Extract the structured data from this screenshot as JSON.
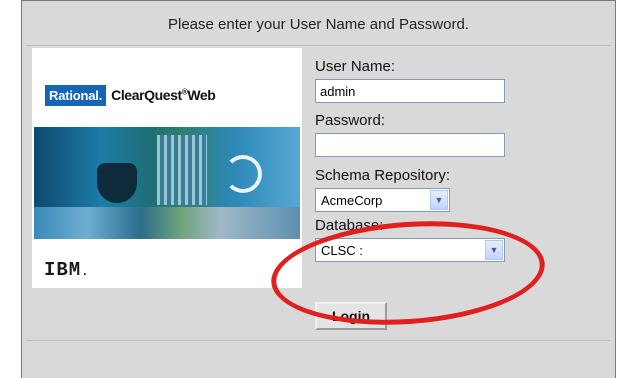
{
  "header": {
    "prompt": "Please enter your User Name and Password."
  },
  "brand": {
    "rational": "Rational.",
    "product": "ClearQuest",
    "registered": "®",
    "product_suffix": "Web",
    "vendor": "IBM",
    "vendor_dot": "."
  },
  "form": {
    "username_label": "User Name:",
    "username_value": "admin",
    "password_label": "Password:",
    "password_value": "",
    "schema_label": "Schema Repository:",
    "schema_value": "AcmeCorp",
    "database_label": "Database:",
    "database_value": "CLSC :",
    "login_label": "Login"
  },
  "colors": {
    "highlight": "#e01f1f",
    "rational_badge": "#1565b5",
    "panel_bg": "#d9d9d9"
  }
}
